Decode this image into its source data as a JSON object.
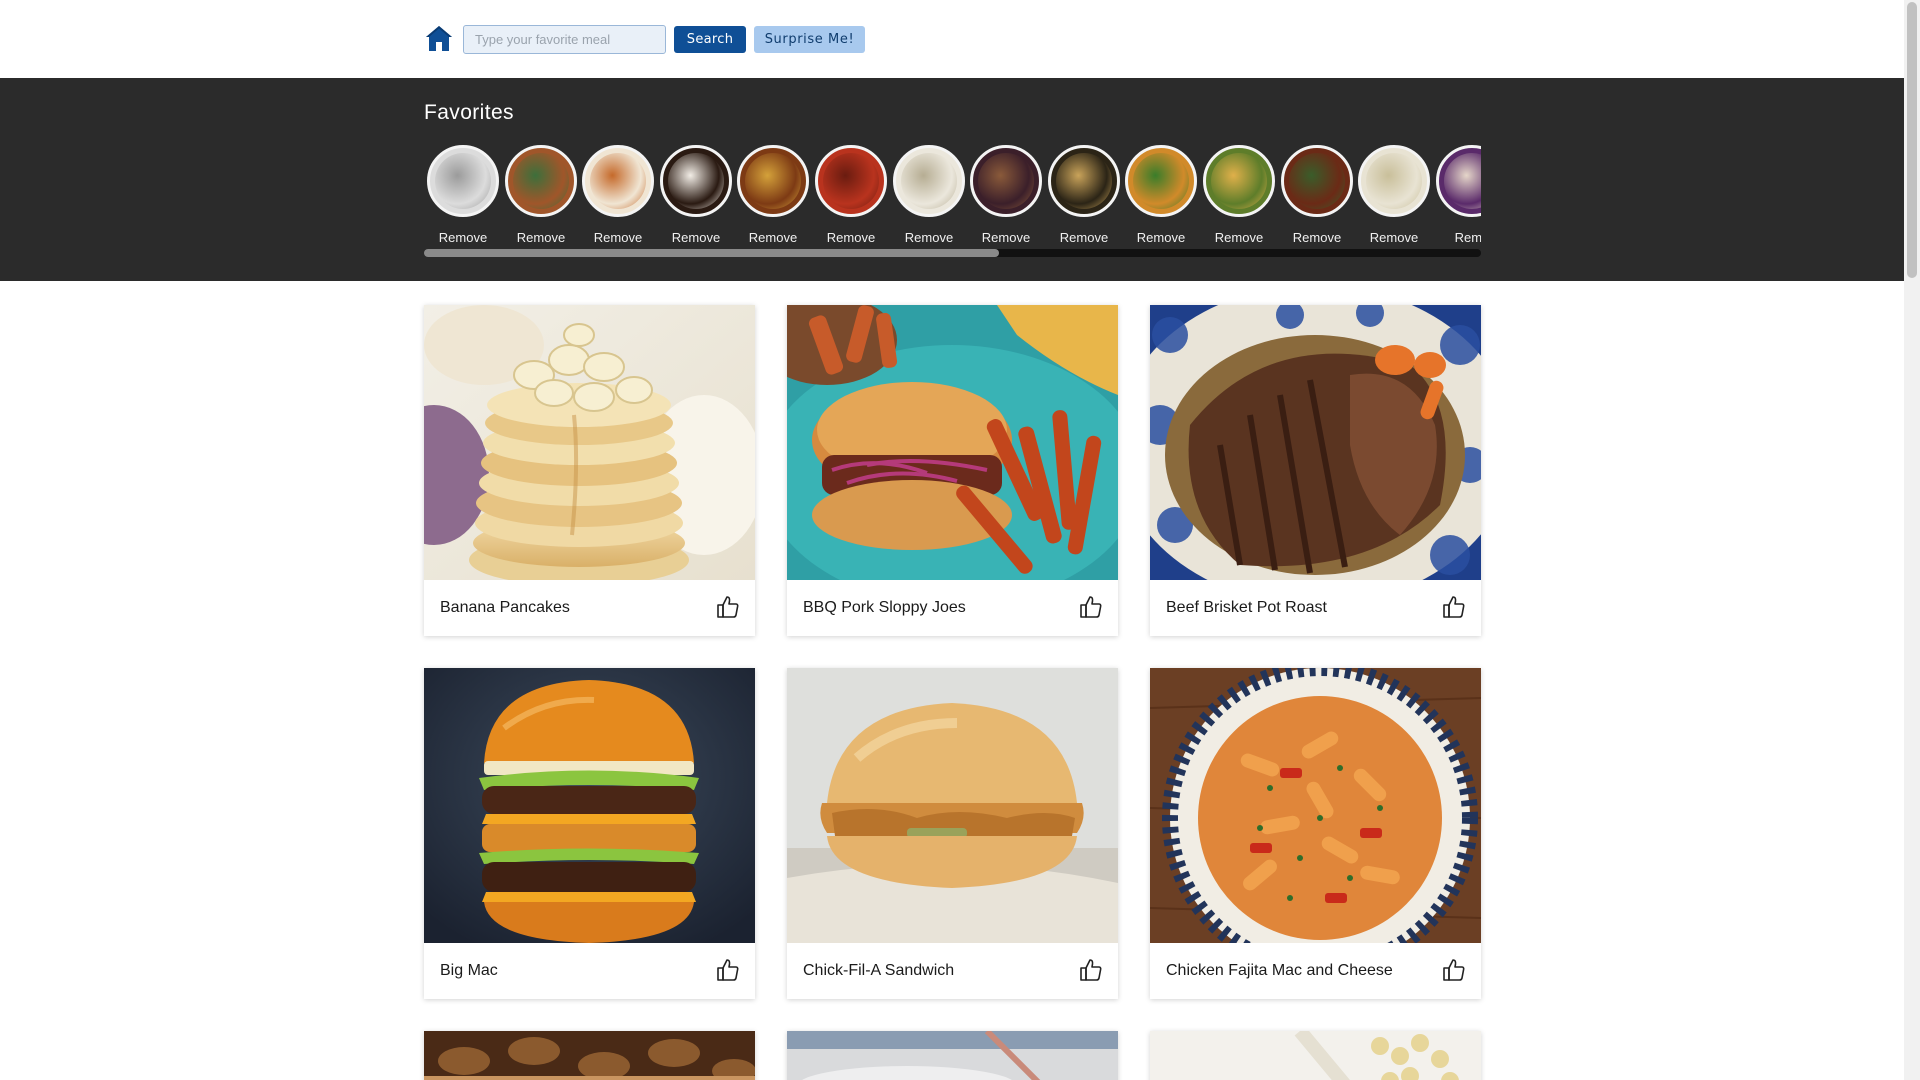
{
  "header": {
    "search_placeholder": "Type your favorite meal",
    "search_value": "",
    "search_label": "Search",
    "surprise_label": "Surprise Me!"
  },
  "favorites": {
    "title": "Favorites",
    "remove_label": "Remove",
    "items": [
      {
        "icon": "food-photo-icon"
      },
      {
        "icon": "food-photo-icon"
      },
      {
        "icon": "food-photo-icon"
      },
      {
        "icon": "food-photo-icon"
      },
      {
        "icon": "food-photo-icon"
      },
      {
        "icon": "food-photo-icon"
      },
      {
        "icon": "food-photo-icon"
      },
      {
        "icon": "food-photo-icon"
      },
      {
        "icon": "food-photo-icon"
      },
      {
        "icon": "food-photo-icon"
      },
      {
        "icon": "food-photo-icon"
      },
      {
        "icon": "food-photo-icon"
      },
      {
        "icon": "food-photo-icon"
      },
      {
        "icon": "food-photo-icon"
      }
    ],
    "remove_truncated": "Remo"
  },
  "meals": [
    {
      "title": "Banana Pancakes"
    },
    {
      "title": "BBQ Pork Sloppy Joes"
    },
    {
      "title": "Beef Brisket Pot Roast"
    },
    {
      "title": "Big Mac"
    },
    {
      "title": "Chick-Fil-A Sandwich"
    },
    {
      "title": "Chicken Fajita Mac and Cheese"
    }
  ],
  "colors": {
    "primary": "#0f4f96",
    "secondary": "#a8c9ee",
    "favorites_bg": "#2b2b2b"
  }
}
